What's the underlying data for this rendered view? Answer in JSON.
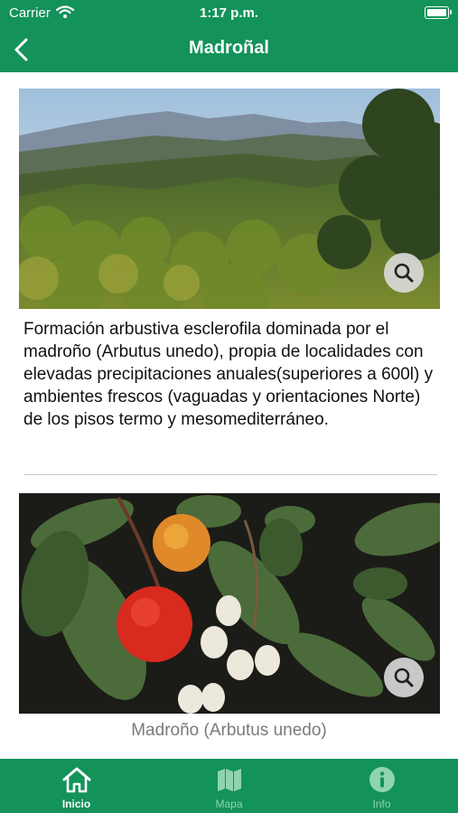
{
  "status": {
    "carrier": "Carrier",
    "time": "1:17 p.m."
  },
  "header": {
    "title": "Madroñal"
  },
  "main": {
    "description": "Formación arbustiva esclerofila dominada por el madroño (Arbutus unedo), propia de localidades con elevadas precipitaciones anuales(superiores a 600l) y ambientes frescos (vaguadas y orientaciones Norte) de los pisos termo y mesomediterráneo.",
    "second_image_caption": "Madroño (Arbutus unedo)"
  },
  "tabs": [
    {
      "label": "Inicio",
      "icon": "home-icon",
      "active": true
    },
    {
      "label": "Mapa",
      "icon": "map-icon",
      "active": false
    },
    {
      "label": "Info",
      "icon": "info-icon",
      "active": false
    }
  ],
  "colors": {
    "brand": "#13925a",
    "tab_inactive": "#8fd4b0"
  }
}
